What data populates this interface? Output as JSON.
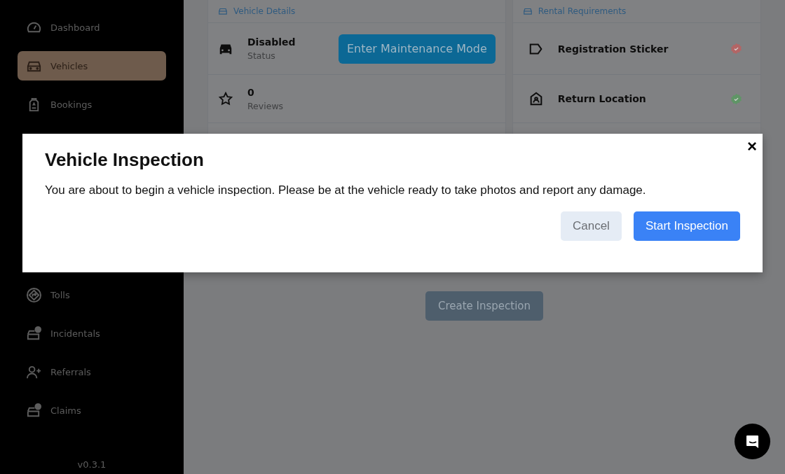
{
  "sidebar": {
    "items": [
      {
        "label": "Dashboard",
        "selected": false
      },
      {
        "label": "Vehicles",
        "selected": true
      },
      {
        "label": "Bookings",
        "selected": false
      }
    ],
    "lower_items": [
      {
        "label": "Tolls",
        "selected": false
      },
      {
        "label": "Incidentals",
        "selected": false
      },
      {
        "label": "Referrals",
        "selected": false
      },
      {
        "label": "Claims",
        "selected": false
      }
    ],
    "version": "v0.3.1"
  },
  "vehicle_details": {
    "title": "Vehicle Details",
    "rows": [
      {
        "value": "Disabled",
        "label": "Status",
        "action": "Enter Maintenance Mode"
      },
      {
        "value": "0",
        "label": "Reviews"
      }
    ]
  },
  "rental_requirements": {
    "title": "Rental Requirements",
    "items": [
      {
        "label": "Registration Sticker",
        "color": "#b36565"
      },
      {
        "label": "Return Location",
        "color": "#5f9566"
      }
    ]
  },
  "create_button": "Create Inspection",
  "dialog": {
    "title": "Vehicle Inspection",
    "message": "You are about to begin a vehicle inspection. Please be at the vehicle ready to take photos and report any damage.",
    "close": "×",
    "buttons": [
      {
        "label": "Cancel",
        "kind": "secondary"
      },
      {
        "label": "Start Inspection",
        "kind": "primary"
      }
    ]
  }
}
